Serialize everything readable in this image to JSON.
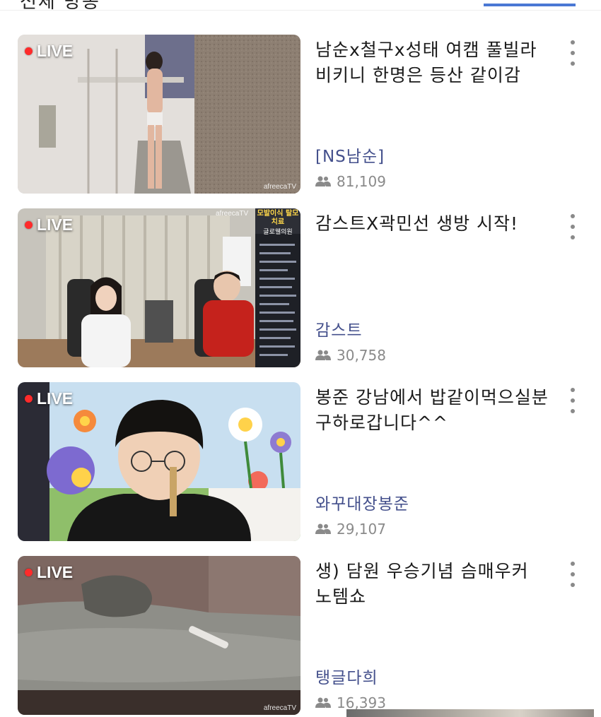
{
  "header": {
    "title": "전체 방송"
  },
  "streams": [
    {
      "live_label": "LIVE",
      "watermark": "afreecaTV",
      "title": "남순x철구x성태 여캠 풀빌라 비키니 한명은 등산 같이감",
      "streamer": "[NS남순]",
      "viewers": "81,109"
    },
    {
      "live_label": "LIVE",
      "watermark": "afreecaTV",
      "overlay_header": "모발이식 탈모치료",
      "overlay_sub": "글로웰의원",
      "title": "감스트X곽민선 생방 시작!",
      "streamer": "감스트",
      "viewers": "30,758"
    },
    {
      "live_label": "LIVE",
      "title": "봉준 강남에서 밥같이먹으실분 구하로갑니다^^",
      "streamer": "와꾸대장봉준",
      "viewers": "29,107"
    },
    {
      "live_label": "LIVE",
      "watermark": "afreecaTV",
      "title": "생) 담원 우승기념 슴매우커 노템쇼",
      "streamer": "탱글다희",
      "viewers": "16,393"
    }
  ],
  "colors": {
    "streamer_name": "#44508c",
    "live_dot": "#ff2b2b",
    "tab_indicator": "#4a78d4",
    "meta_gray": "#8a8a8a"
  },
  "icons": {
    "viewers": "people-icon",
    "more": "more-vertical-icon"
  }
}
